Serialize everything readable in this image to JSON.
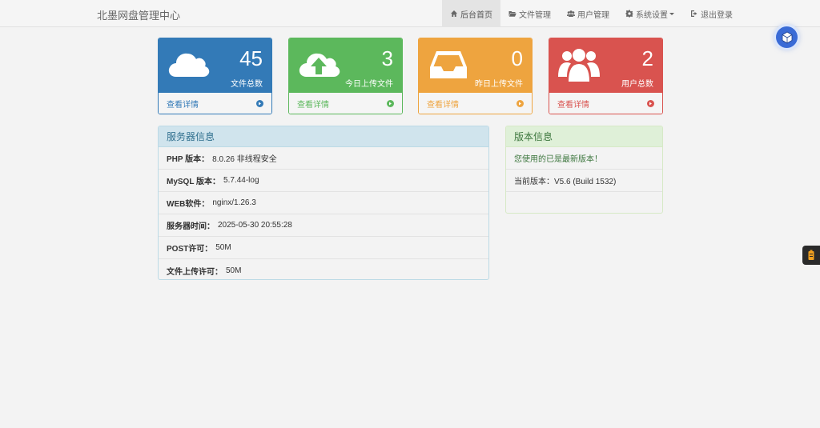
{
  "app": {
    "title": "北墨网盘管理中心"
  },
  "nav": {
    "items": [
      {
        "label": "后台首页",
        "icon": "home-icon",
        "active": true
      },
      {
        "label": "文件管理",
        "icon": "folder-open-icon"
      },
      {
        "label": "用户管理",
        "icon": "users-icon"
      },
      {
        "label": "系统设置",
        "icon": "gear-icon",
        "dropdown": true
      },
      {
        "label": "退出登录",
        "icon": "sign-out-icon"
      }
    ]
  },
  "stats": [
    {
      "value": "45",
      "label": "文件总数",
      "link": "查看详情",
      "icon": "cloud-icon",
      "color": "#337ab7"
    },
    {
      "value": "3",
      "label": "今日上传文件",
      "link": "查看详情",
      "icon": "cloud-upload-icon",
      "color": "#5cb85c"
    },
    {
      "value": "0",
      "label": "昨日上传文件",
      "link": "查看详情",
      "icon": "inbox-icon",
      "color": "#eea43f"
    },
    {
      "value": "2",
      "label": "用户总数",
      "link": "查看详情",
      "icon": "users-icon",
      "color": "#d9534f"
    }
  ],
  "server": {
    "title": "服务器信息",
    "rows": [
      {
        "key": "PHP 版本：",
        "value": "8.0.26 非线程安全"
      },
      {
        "key": "MySQL 版本：",
        "value": "5.7.44-log"
      },
      {
        "key": "WEB软件：",
        "value": "nginx/1.26.3"
      },
      {
        "key": "服务器时间：",
        "value": "2025-05-30 20:55:28"
      },
      {
        "key": "POST许可：",
        "value": "50M"
      },
      {
        "key": "文件上传许可：",
        "value": "50M"
      }
    ]
  },
  "version": {
    "title": "版本信息",
    "status": "您使用的已是最新版本！",
    "current": "当前版本：V5.6 (Build 1532)"
  }
}
